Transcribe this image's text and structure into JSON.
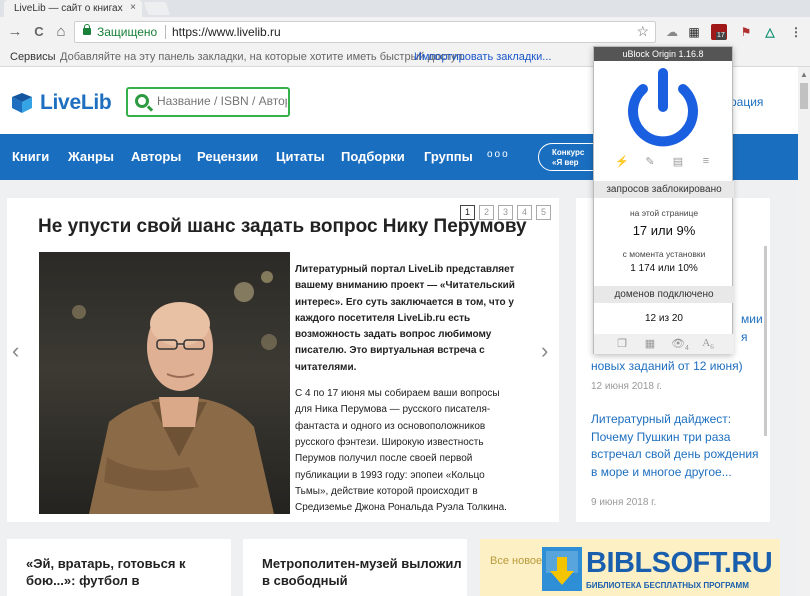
{
  "browser": {
    "tab_title": "LiveLib — сайт о книгах",
    "tab_close": "×",
    "nav": {
      "back": "→",
      "reload": "C",
      "home": "⌂"
    },
    "secure_label": "Защищено",
    "url": "https://www.livelib.ru",
    "star": "☆",
    "ext_badge": "17",
    "bookmarks": {
      "apps_label": "Сервисы",
      "hint": "Добавляйте на эту панель закладки, на которые хотите иметь быстрый доступ.",
      "import_link": "Импортировать закладки..."
    }
  },
  "site": {
    "logo": "LiveLib",
    "search_placeholder": "Название / ISBN / Автор",
    "header_right": "рация",
    "nav_items": [
      "Книги",
      "Жанры",
      "Авторы",
      "Рецензии",
      "Цитаты",
      "Подборки",
      "Группы"
    ],
    "nav_more": "ооо",
    "contest_lines": [
      "Конкурс",
      "«Я вер"
    ],
    "pager": [
      "1",
      "2",
      "3",
      "4",
      "5"
    ],
    "headline": "Не упусти свой шанс задать вопрос Нику Перумову",
    "lead": "Литературный портал LiveLib представляет вашему вниманию проект — «Читательский интерес». Его суть заключается в том, что у каждого посетителя LiveLib.ru есть возможность задать вопрос любимому писателю. Это виртуальная встреча с читателями.",
    "body": "С 4 по 17 июня мы собираем ваши вопросы для Ника Перумова — русского писателя-фантаста и одного из основоположников русского фэнтези. Широкую известность Перумов получил после своей первой публикации в 1993 году: эпопеи «Кольцо Тьмы», действие которой происходит в Средиземье Джона Рональда Руэла Толкина.",
    "arrow_left": "‹",
    "arrow_right": "›",
    "right_col": {
      "line1": "мии",
      "line2": "я",
      "item1_tail": "новых заданий от 12 июня)",
      "item1_date": "12 июня 2018 г.",
      "item2": "Литературный дайджест: Почему Пушкин три раза встречал свой день рождения в море и многое другое...",
      "item2_date": "9 июня 2018 г."
    },
    "bottom_cards": [
      "«Эй, вратарь, готовься к бою...»: футбол в",
      "Метрополитен-музей выложил в свободный"
    ],
    "bottom_card3": "Все новое"
  },
  "watermark": {
    "title": "BIBLSOFT.RU",
    "subtitle": "БИБЛИОТЕКА БЕСПЛАТНЫХ ПРОГРАММ"
  },
  "ublock": {
    "title": "uBlock Origin 1.16.8",
    "blocked_header": "запросов заблокировано",
    "on_page_label": "на этой странице",
    "on_page_value": "17 или 9%",
    "since_install_label": "с момента установки",
    "since_install_value": "1 174 или 10%",
    "domains_header": "доменов подключено",
    "domains_value": "12 из 20",
    "tools": [
      "⚡",
      "✎",
      "▤",
      "≡"
    ],
    "footer": [
      "❐",
      "▦",
      "👁",
      "A"
    ],
    "footer_subs": [
      "",
      "",
      "4",
      "6"
    ],
    "power_color": "#1a5fe0"
  }
}
